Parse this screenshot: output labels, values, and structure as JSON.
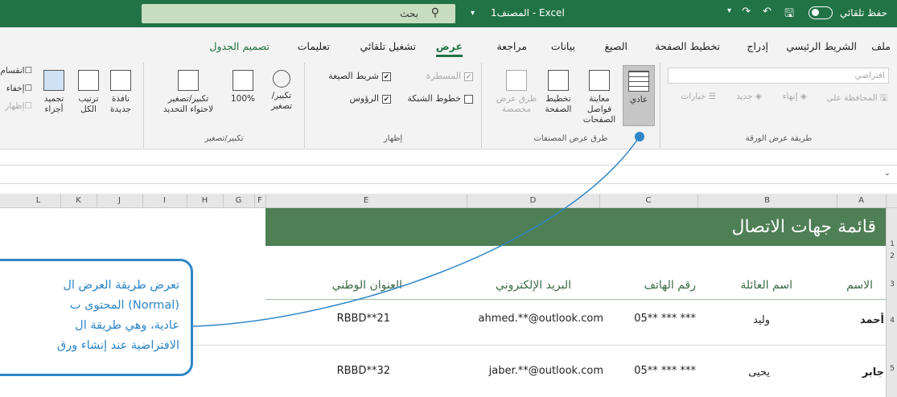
{
  "titlebar": {
    "autosave_label": "حفظ تلقائي",
    "window_title": "المصنف1 - Excel",
    "search_placeholder": "بحث"
  },
  "tabs": [
    {
      "label": "ملف"
    },
    {
      "label": "الشريط الرئيسي"
    },
    {
      "label": "إدراج"
    },
    {
      "label": "تخطيط الصفحة"
    },
    {
      "label": "الصيغ"
    },
    {
      "label": "بيانات"
    },
    {
      "label": "مراجعة"
    },
    {
      "label": "عرض",
      "active": true
    },
    {
      "label": "تشغيل تلقائي"
    },
    {
      "label": "تعليمات"
    },
    {
      "label": "تصميم الجدول",
      "accent": true
    }
  ],
  "ribbon": {
    "sheet_view": {
      "combo_value": "افتراضي",
      "keep": "المحافظة على",
      "exit": "إنهاء",
      "new": "جديد",
      "options": "خيارات",
      "label": "طريقة عرض الورقة"
    },
    "workbook_views": {
      "normal": "عادي",
      "page_break": "معاينة فواصل الصفحات",
      "page_layout": "تخطيط الصفحة",
      "custom": "طرق عرض مخصصة",
      "label": "طرق عرض المصنفات"
    },
    "show": {
      "ruler": "المسطرة",
      "gridlines": "خطوط الشبكة",
      "formula_bar": "شريط الصيغة",
      "headings": "الرؤوس",
      "label": "إظهار"
    },
    "zoom": {
      "zoom": "تكبير/ تصغير",
      "hundred": "100%",
      "zoom_to_selection": "تكبير/تصغير لاحتواء التحديد",
      "label": "تكبير/تصغير"
    },
    "window": {
      "new_window": "نافذة جديدة",
      "arrange_all": "ترتيب الكل",
      "freeze_panes": "تجميد أجزاء",
      "split": "انقسام",
      "hide": "إخفاء",
      "unhide": "إظهار"
    }
  },
  "columns": [
    "A",
    "B",
    "C",
    "D",
    "E",
    "F",
    "G",
    "H",
    "I",
    "J",
    "K",
    "L"
  ],
  "rows": [
    "1",
    "2",
    "3",
    "4",
    "5"
  ],
  "sheet": {
    "title": "قائمة جهات الاتصال",
    "headers": {
      "first_name": "الاسم",
      "last_name": "اسم العائلة",
      "phone": "رقم الهاتف",
      "email": "البريد الإلكتروني",
      "national_address": "العنوان الوطني"
    },
    "records": [
      {
        "first_name": "أحمد",
        "last_name": "وليد",
        "phone": "05** *** ***",
        "email": "ahmed.**@outlook.com",
        "national_address": "RBBD**21"
      },
      {
        "first_name": "جابر",
        "last_name": "يحيى",
        "phone": "05** *** ***",
        "email": "jaber.**@outlook.com",
        "national_address": "RBBD**32"
      }
    ]
  },
  "callout": {
    "line1": "تعرض طريقة العرض ال",
    "line2": "(Normal) المحتوى ب",
    "line3": "عادية، وهي طريقة ال",
    "line4": "الافتراضية عند إنشاء ورق"
  },
  "colors": {
    "brand": "#217346",
    "banner": "#4f7f55",
    "callout": "#2e86c8"
  }
}
